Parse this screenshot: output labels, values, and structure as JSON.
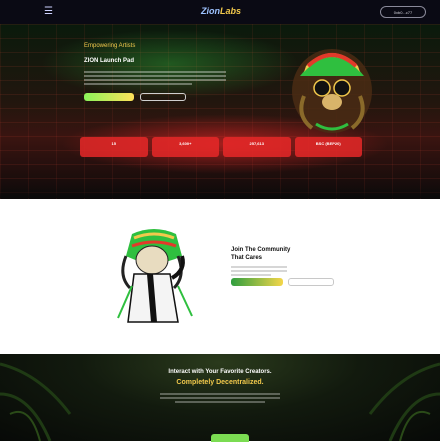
{
  "nav": {
    "menu_icon": "hamburger-icon",
    "logo_part1": "Zion",
    "logo_part2": "Labs",
    "connect_label": "0xb0...c77"
  },
  "hero": {
    "eyebrow": "Empowering Artists",
    "title": "ZION Launch Pad",
    "primary_button": "",
    "secondary_button": "",
    "stats": [
      {
        "value": "15",
        "label": ""
      },
      {
        "value": "3,600+",
        "label": ""
      },
      {
        "value": "257,613",
        "label": ""
      },
      {
        "value": "BSC (BEP20)",
        "label": ""
      }
    ]
  },
  "community": {
    "title_line1": "Join The Community",
    "title_line2": "That Cares",
    "primary_button": "",
    "secondary_button": ""
  },
  "bottom": {
    "title_line1": "Interact with Your Favorite Creators.",
    "title_line2": "Completely Decentralized."
  },
  "colors": {
    "accent_gold": "#f2c94c",
    "hero_red": "#e62828",
    "accent_green": "#7bdc52"
  }
}
